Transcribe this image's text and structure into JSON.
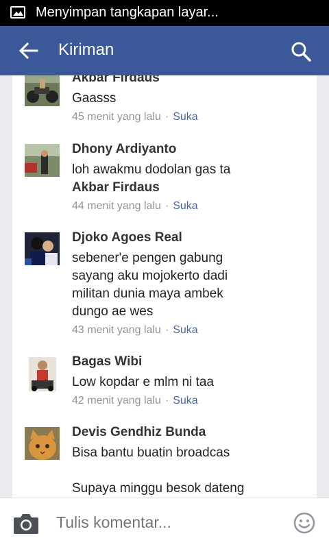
{
  "status_bar": {
    "text": "Menyimpan tangkapan layar..."
  },
  "app_bar": {
    "title": "Kiriman"
  },
  "comments": [
    {
      "name": "Akbar Firdaus",
      "text": "Gaasss",
      "mention": "",
      "time": "45 menit yang lalu",
      "like": "Suka"
    },
    {
      "name": "Dhony Ardiyanto",
      "text": "loh awakmu dodolan gas ta",
      "mention": "Akbar Firdaus",
      "time": "44 menit yang lalu",
      "like": "Suka"
    },
    {
      "name": "Djoko Agoes Real",
      "text": "sebener'e pengen gabung\nsayang aku mojokerto dadi\nmilitan dunia maya ambek\ndungo ae wes",
      "mention": "",
      "time": "43 menit yang lalu",
      "like": "Suka"
    },
    {
      "name": "Bagas Wibi",
      "text": "Low kopdar e mlm ni taa",
      "mention": "",
      "time": "42 menit yang lalu",
      "like": "Suka"
    },
    {
      "name": "Devis Gendhiz Bunda",
      "text": "Bisa bantu buatin broadcas\n\nSupaya minggu besok dateng",
      "mention": "",
      "time": "",
      "like": ""
    }
  ],
  "composer": {
    "placeholder": "Tulis komentar..."
  },
  "meta_separator": "·",
  "icons": {
    "back": "arrow-left-icon",
    "search": "search-icon",
    "camera": "camera-icon",
    "emoji": "smiley-icon",
    "status": "image-icon"
  },
  "colors": {
    "app_bar": "#3b5998",
    "like_link": "#4b67a1",
    "meta": "#90949c"
  }
}
